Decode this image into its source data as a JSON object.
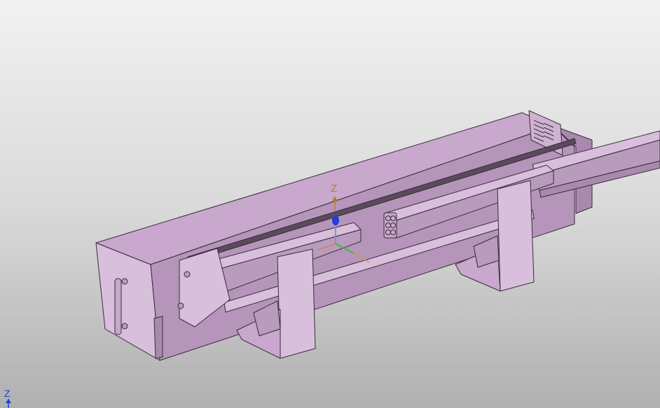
{
  "viewport": {
    "background_top": "#f1f1f1",
    "background_bottom": "#b0b0b0"
  },
  "model": {
    "part_color": "#c8a8cc",
    "part_color_light": "#d8bfdc",
    "part_color_dark": "#a98aae",
    "edge_color": "#3a2a3c"
  },
  "compass": {
    "z_label": "Z",
    "z_color": "#c07820",
    "z_arrow_color": "#1f3fd6",
    "x_color": "#d98060",
    "y_color": "#4caf50"
  },
  "corner_axis": {
    "label": "Z",
    "color": "#1f3fd6"
  }
}
